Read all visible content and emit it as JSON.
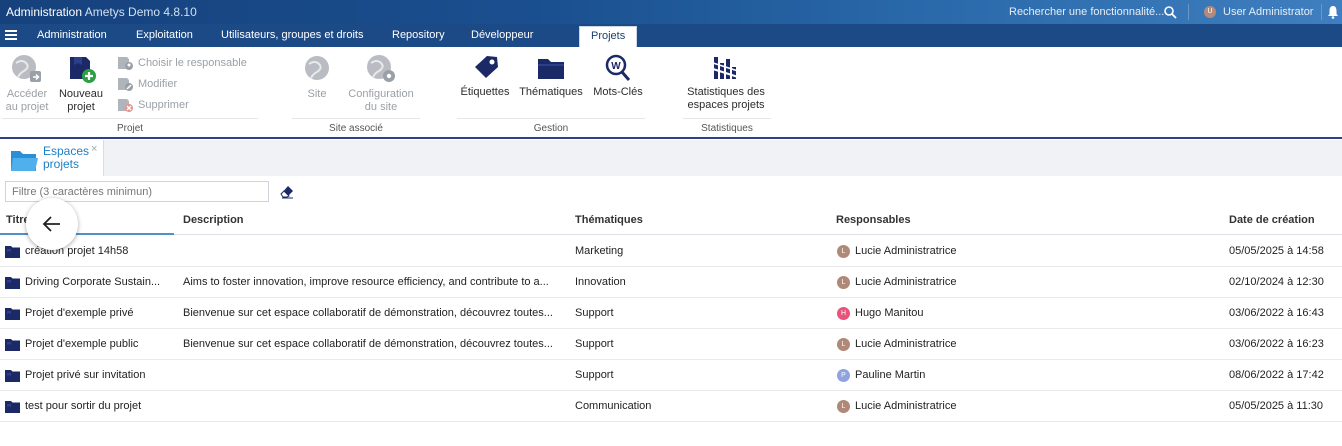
{
  "topbar": {
    "app_title": "Administration",
    "app_version": "Ametys Demo 4.8.10",
    "search_placeholder": "Rechercher une fonctionnalité...",
    "user_initial": "U",
    "user_name": "User Administrator"
  },
  "menu": {
    "tabs": [
      "Administration",
      "Exploitation",
      "Utilisateurs, groupes et droits",
      "Repository",
      "Développeur",
      "Projets"
    ],
    "active_tab": "Projets"
  },
  "ribbon": {
    "projet": {
      "label": "Projet",
      "acceder": [
        "Accéder",
        "au projet"
      ],
      "nouveau": [
        "Nouveau",
        "projet"
      ],
      "choisir": "Choisir le responsable",
      "modifier": "Modifier",
      "supprimer": "Supprimer"
    },
    "site": {
      "label": "Site associé",
      "site": "Site",
      "configuration": [
        "Configuration",
        "du site"
      ]
    },
    "gestion": {
      "label": "Gestion",
      "etiquettes": "Étiquettes",
      "thematiques": "Thématiques",
      "motscles": "Mots-Clés"
    },
    "statistiques": {
      "label": "Statistiques",
      "stats": [
        "Statistiques des",
        "espaces projets"
      ]
    }
  },
  "doc_tab": {
    "title": [
      "Espaces",
      "projets"
    ],
    "close": "×"
  },
  "filter": {
    "placeholder": "Filtre (3 caractères minimun)"
  },
  "grid": {
    "columns": [
      "Titre",
      "Description",
      "Thématiques",
      "Responsables",
      "Date de création"
    ],
    "rows": [
      {
        "titre": "création projet 14h58",
        "description": "",
        "thematique": "Marketing",
        "responsable": "Lucie Administratrice",
        "initial": "L",
        "avatar_color": "#b08878",
        "date": "05/05/2025 à 14:58"
      },
      {
        "titre": "Driving Corporate Sustain...",
        "description": "Aims to foster innovation, improve resource efficiency, and contribute to a...",
        "thematique": "Innovation",
        "responsable": "Lucie Administratrice",
        "initial": "L",
        "avatar_color": "#b08878",
        "date": "02/10/2024 à 12:30"
      },
      {
        "titre": "Projet d'exemple privé",
        "description": "Bienvenue sur cet espace collaboratif de démonstration, découvrez toutes...",
        "thematique": "Support",
        "responsable": "Hugo Manitou",
        "initial": "H",
        "avatar_color": "#e8537a",
        "date": "03/06/2022 à 16:43"
      },
      {
        "titre": "Projet d'exemple public",
        "description": "Bienvenue sur cet espace collaboratif de démonstration, découvrez toutes...",
        "thematique": "Support",
        "responsable": "Lucie Administratrice",
        "initial": "L",
        "avatar_color": "#b08878",
        "date": "03/06/2022 à 16:23"
      },
      {
        "titre": "Projet privé sur invitation",
        "description": "",
        "thematique": "Support",
        "responsable": "Pauline Martin",
        "initial": "P",
        "avatar_color": "#8fa3e0",
        "date": "08/06/2022 à 17:42"
      },
      {
        "titre": "test pour sortir du projet",
        "description": "",
        "thematique": "Communication",
        "responsable": "Lucie Administratrice",
        "initial": "L",
        "avatar_color": "#b08878",
        "date": "05/05/2025 à 11:30"
      }
    ]
  }
}
